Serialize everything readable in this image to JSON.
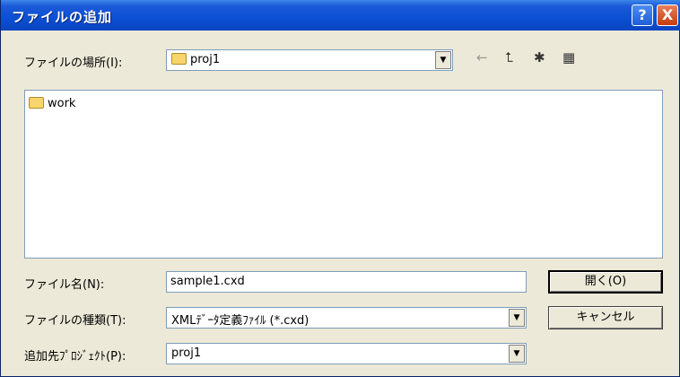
{
  "window": {
    "title": "ファイルの追加"
  },
  "titlebar_buttons": {
    "help": "?",
    "close": "X"
  },
  "look_in": {
    "label": "ファイルの場所(I):",
    "value": "proj1"
  },
  "toolbar": {
    "back": "←",
    "up": "⮤",
    "new_folder": "✱",
    "view": "▦"
  },
  "file_list": {
    "items": [
      {
        "name": "work",
        "type": "folder"
      }
    ]
  },
  "file_name": {
    "label": "ファイル名(N):",
    "value": "sample1.cxd"
  },
  "file_type": {
    "label": "ファイルの種類(T):",
    "value": "XMLﾃﾞｰﾀ定義ﾌｧｲﾙ (*.cxd)"
  },
  "target_project": {
    "label": "追加先ﾌﾟﾛｼﾞｪｸﾄ(P):",
    "value": "proj1"
  },
  "buttons": {
    "open": "開く(O)",
    "cancel": "キャンセル"
  },
  "dropdown_arrow": "▼"
}
